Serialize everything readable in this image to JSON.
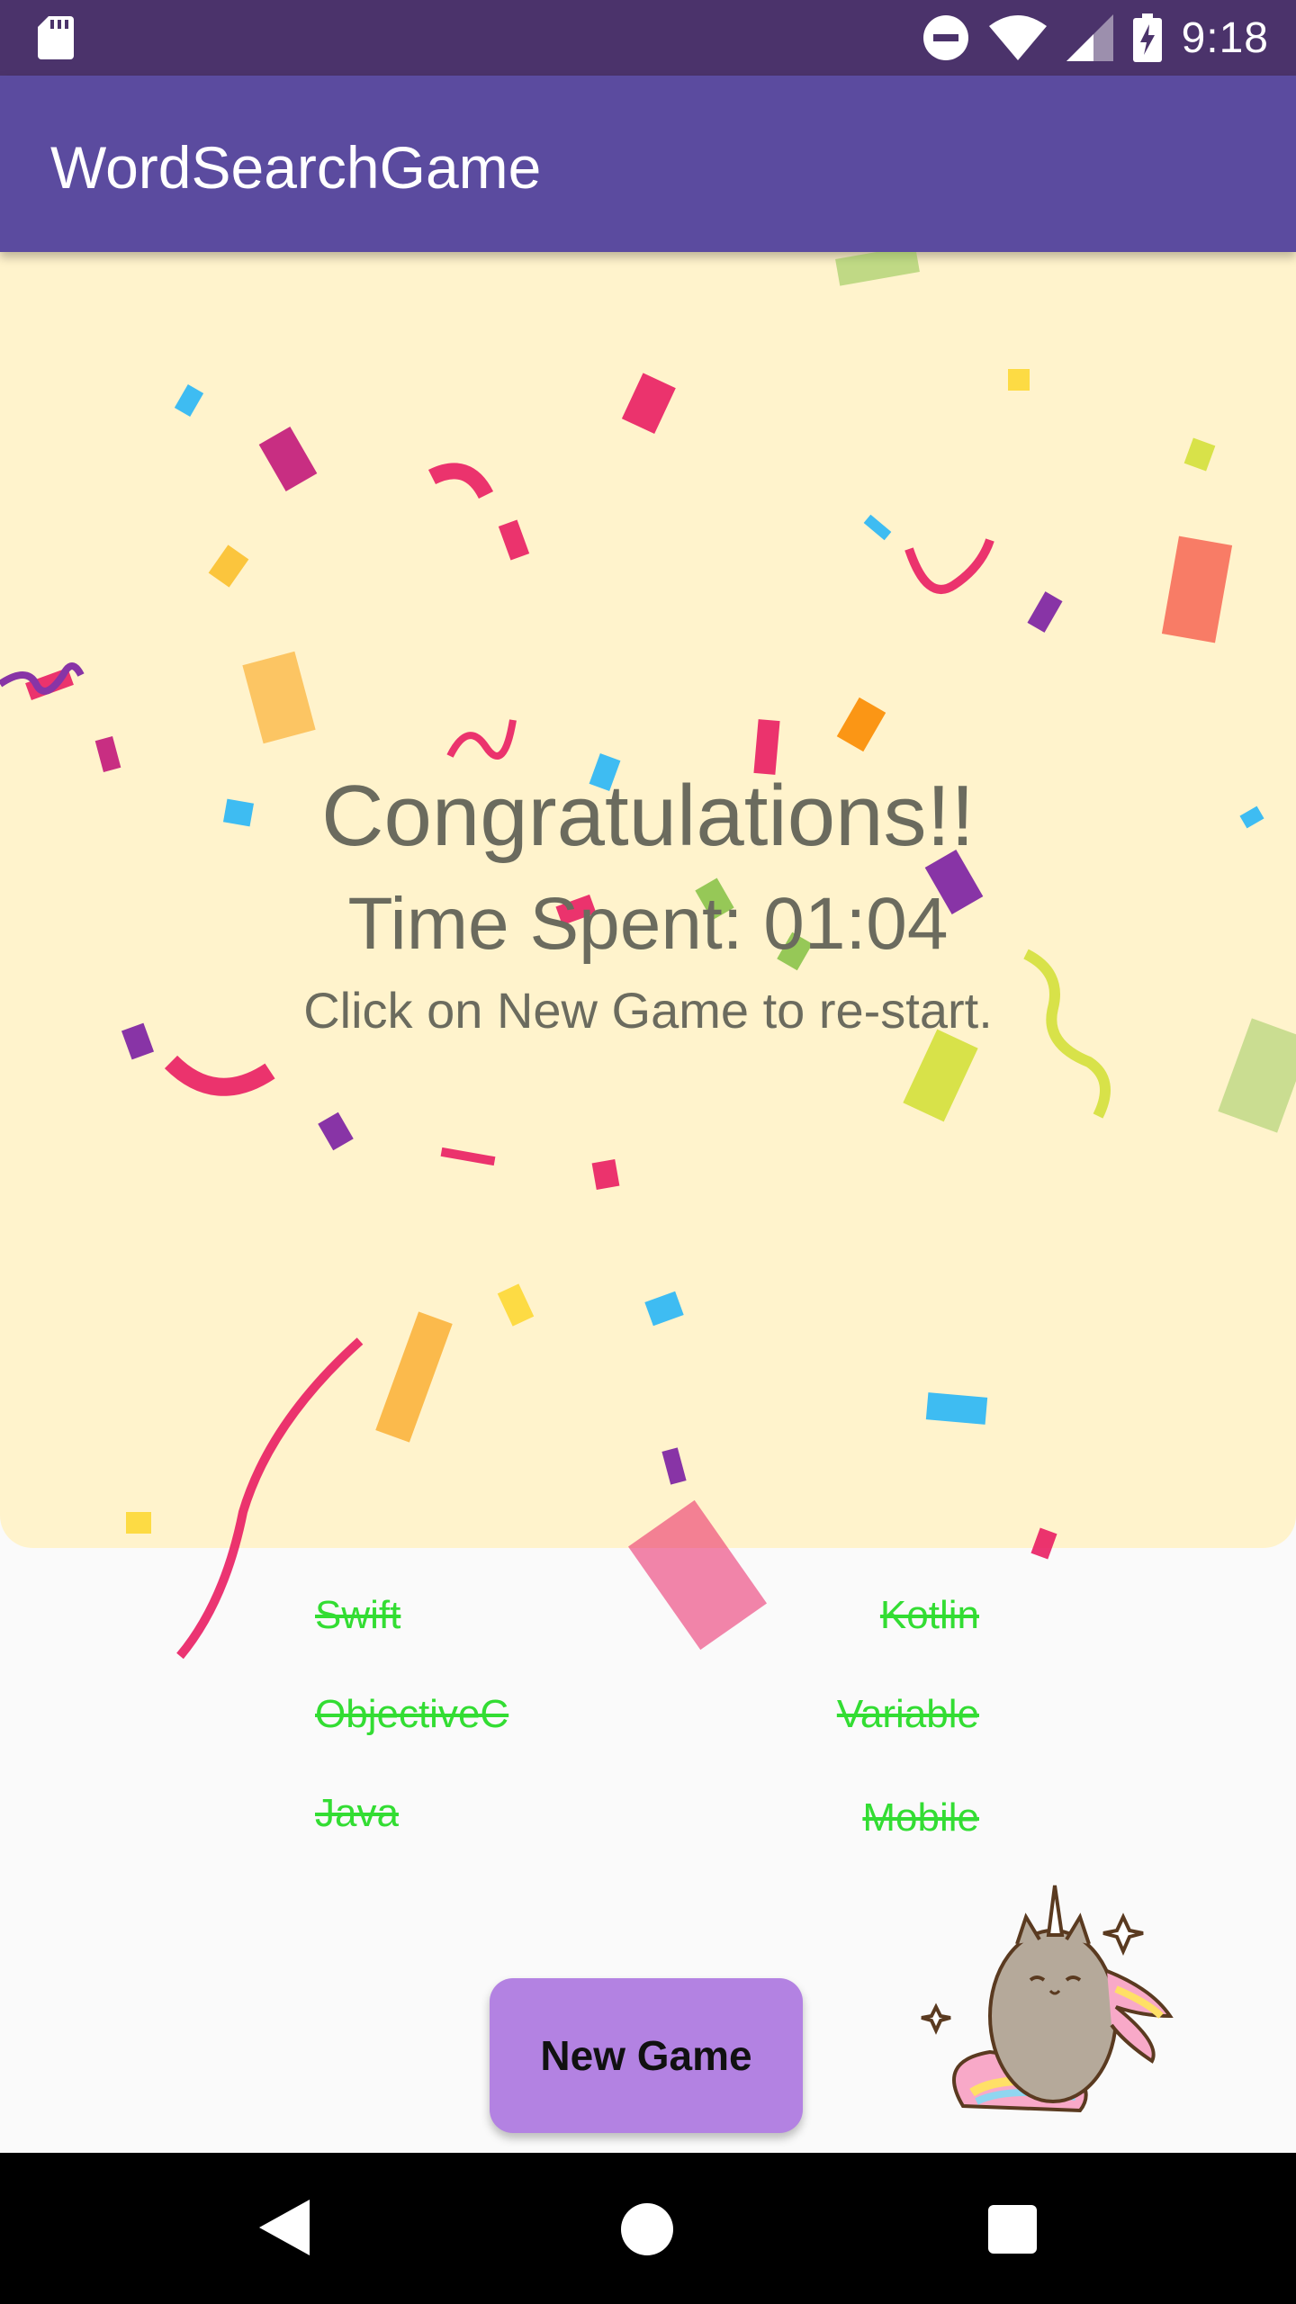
{
  "status_bar": {
    "time": "9:18",
    "icons": [
      "sd-card-icon",
      "do-not-disturb-icon",
      "wifi-icon",
      "cellular-signal-icon",
      "battery-charging-icon"
    ]
  },
  "app_bar": {
    "title": "WordSearchGame"
  },
  "celebration": {
    "title": "Congratulations!!",
    "time_spent": "Time Spent: 01:04",
    "hint": "Click on New Game to re-start."
  },
  "words": {
    "left": [
      "Swift",
      "ObjectiveC",
      "Java"
    ],
    "right": [
      "Kotlin",
      "Variable",
      "Mobile"
    ],
    "found_color": "#33dd33"
  },
  "buttons": {
    "new_game": "New Game"
  },
  "colors": {
    "status_bar": "#4b336b",
    "app_bar": "#5b4b9f",
    "panel_background": "#fff3cc",
    "button": "#b382e2"
  }
}
